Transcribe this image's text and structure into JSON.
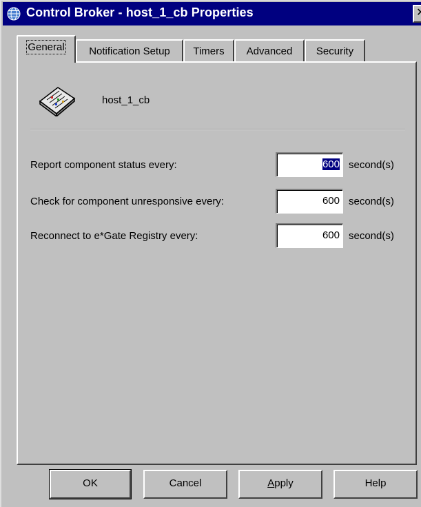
{
  "window": {
    "title": "Control Broker - host_1_cb Properties",
    "close_glyph": "✕",
    "title_icon": "globe-icon"
  },
  "tabs": [
    {
      "label": "General",
      "active": true
    },
    {
      "label": "Notification Setup",
      "active": false
    },
    {
      "label": "Timers",
      "active": false
    },
    {
      "label": "Advanced",
      "active": false
    },
    {
      "label": "Security",
      "active": false
    }
  ],
  "general": {
    "component_icon": "control-broker-icon",
    "component_name": "host_1_cb",
    "rows": [
      {
        "label": "Report component status every:",
        "value": "600",
        "unit": "second(s)",
        "selected": true
      },
      {
        "label": "Check for component unresponsive every:",
        "value": "600",
        "unit": "second(s)",
        "selected": false
      },
      {
        "label": "Reconnect to e*Gate Registry every:",
        "value": "600",
        "unit": "second(s)",
        "selected": false
      }
    ]
  },
  "buttons": {
    "ok": "OK",
    "cancel": "Cancel",
    "apply_accel": "A",
    "apply_rest": "pply",
    "help": "Help"
  },
  "colors": {
    "titlebar": "#000080",
    "face": "#c0c0c0",
    "selection": "#000080"
  }
}
